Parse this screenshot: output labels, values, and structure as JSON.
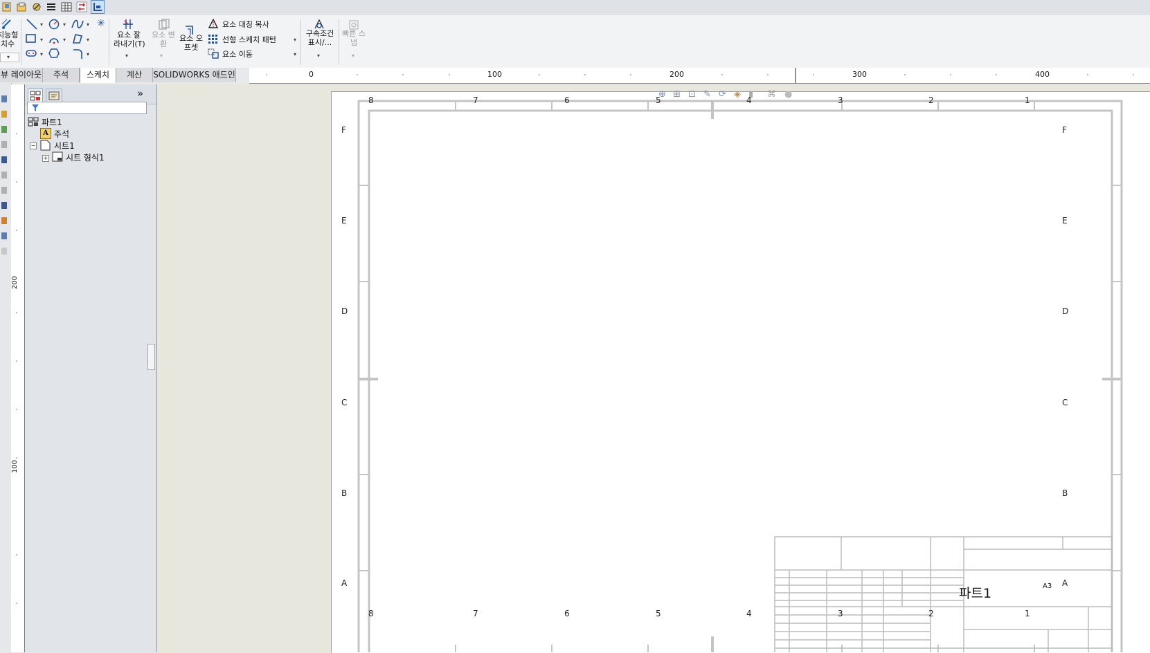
{
  "ribbon": {
    "smart_dimension": "지능형\n치수",
    "trim": "요소 잘\n라내기(T)",
    "convert": "요소 변\n환",
    "offset": "요소 오\n프셋",
    "mirror": "요소 대칭 복사",
    "linear_pattern": "선형 스케치 패턴",
    "move": "요소 이동",
    "relations": "구속조건\n표시/...",
    "rapid_sketch": "빠른 스\n냅"
  },
  "tabs": [
    {
      "label": "뷰 레이아웃",
      "active": false
    },
    {
      "label": "주석",
      "active": false
    },
    {
      "label": "스케치",
      "active": true
    },
    {
      "label": "계산",
      "active": false
    },
    {
      "label": "SOLIDWORKS 애드인",
      "active": false
    }
  ],
  "ruler": {
    "h_labels": [
      "0",
      "100",
      "200",
      "300",
      "400"
    ],
    "v_labels": [
      "200",
      "100"
    ]
  },
  "feature_tree": {
    "root": "파트1",
    "annotations": "주석",
    "sheet": "시트1",
    "sheet_format": "시트 형식1"
  },
  "drawing": {
    "top_zones": [
      "8",
      "7",
      "6",
      "5",
      "4",
      "3",
      "2",
      "1"
    ],
    "side_zones": [
      "F",
      "E",
      "D",
      "C",
      "B",
      "A"
    ],
    "title": "파트1",
    "size": "A3"
  },
  "colors": {
    "accent": "#1f5fbf",
    "border_gray": "#c4c4c4"
  }
}
